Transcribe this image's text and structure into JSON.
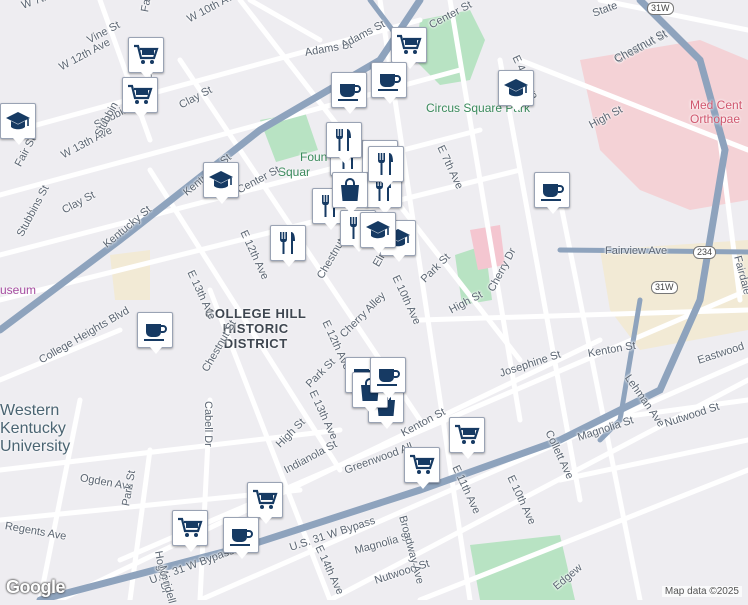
{
  "map": {
    "colors": {
      "background": "#eeedf1",
      "street": "#ffffff",
      "highway": "#8ea3bd",
      "park": "#b8e3c3",
      "hospital_area": "#f4d2d6",
      "campus": "#f2ead5",
      "marker_icon": "#163a63"
    },
    "district_label": [
      "COLLEGE HILL",
      "HISTORIC",
      "DISTRICT"
    ],
    "university_label": [
      "Western",
      "Kentucky",
      "University"
    ],
    "park_labels": {
      "circus_square": "Circus Square Park",
      "fountain": "Foun",
      "square": "Squar"
    },
    "poi_labels": {
      "museum": "useum",
      "med_center": "Med Cent",
      "orthopaedic": "Orthopae"
    },
    "shields": {
      "us31w_a": "31W",
      "us31w_b": "31W",
      "route234": "234"
    },
    "street_labels": [
      "W 10th Ave",
      "W 12th Ave",
      "W 13th Ave",
      "Vine St",
      "Clay St",
      "Clay St",
      "Fair St",
      "Stubbins St",
      "Stubbins St",
      "Adams St",
      "Adams St",
      "Kentucky St",
      "Kentucky St",
      "Center St",
      "Center St",
      "Chestnut St",
      "Chestnut St",
      "Chestnut St",
      "E 12th Ave",
      "E 12th Ave",
      "E 13th Ave",
      "E 13th Ave",
      "E 14th Ave",
      "E 10th Ave",
      "E 10th Ave",
      "E 11th Ave",
      "E 7th Ave",
      "E 4th Ave",
      "Elm",
      "Cherry Alley",
      "Park St",
      "Park St",
      "High St",
      "High St",
      "High St",
      "Cherry Dr",
      "Josephine St",
      "Kenton St",
      "Kenton St",
      "Fairview Ave",
      "Fairdale",
      "Lehman Ave",
      "Eastwood",
      "Collett Ave",
      "Magnolia St",
      "Magnolia St",
      "Nutwood St",
      "Nutwood St",
      "Greenwood All",
      "Broadway Ave",
      "Indianola St",
      "Ogden Ave",
      "Regents Ave",
      "Cabell Dr",
      "Park St",
      "Hogle Dr",
      "Meridell",
      "U.S. 31 W Bypass",
      "U.S. 31 W Bypass",
      "College Heights Blvd",
      "Edgew",
      "Fair",
      "e",
      "Stubbin",
      "State",
      "Chestnut St",
      "W 7th Ave"
    ],
    "markers": [
      {
        "icon": "cart-icon"
      },
      {
        "icon": "cart-icon"
      },
      {
        "icon": "cart-icon"
      },
      {
        "icon": "coffee-icon"
      },
      {
        "icon": "coffee-icon"
      },
      {
        "icon": "coffee-icon"
      },
      {
        "icon": "cap-icon"
      },
      {
        "icon": "cap-icon"
      },
      {
        "icon": "cap-icon"
      },
      {
        "icon": "cap-icon"
      },
      {
        "icon": "fork-knife-icon"
      },
      {
        "icon": "fork-knife-icon"
      },
      {
        "icon": "fork-knife-icon"
      },
      {
        "icon": "fork-knife-icon"
      },
      {
        "icon": "fork-knife-icon"
      },
      {
        "icon": "fork-knife-icon"
      },
      {
        "icon": "fork-knife-icon"
      },
      {
        "icon": "bag-icon"
      },
      {
        "icon": "coffee-icon"
      },
      {
        "icon": "cap-icon"
      },
      {
        "icon": "fork-knife-icon"
      },
      {
        "icon": "coffee-icon"
      },
      {
        "icon": "bag-icon"
      },
      {
        "icon": "bag-icon"
      },
      {
        "icon": "cart-icon"
      },
      {
        "icon": "cart-icon"
      },
      {
        "icon": "cart-icon"
      },
      {
        "icon": "cart-icon"
      },
      {
        "icon": "coffee-icon"
      },
      {
        "icon": "coffee-icon"
      }
    ],
    "attribution": "Map data ©2025",
    "logo": "Google"
  }
}
